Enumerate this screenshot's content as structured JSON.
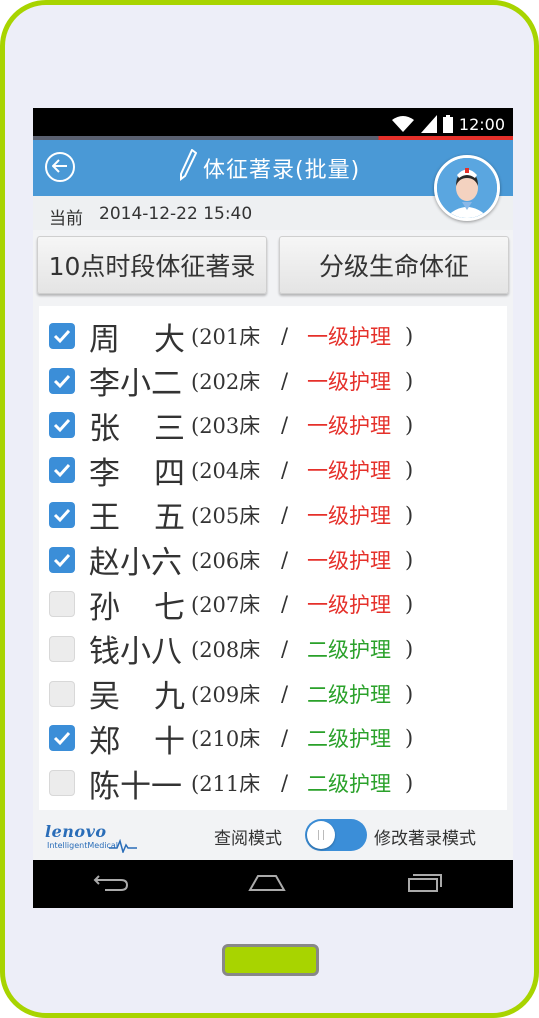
{
  "status_bar": {
    "time": "12:00"
  },
  "header": {
    "title": "体征著录(批量)"
  },
  "date": {
    "label": "当前",
    "value": "2014-12-22 15:40"
  },
  "buttons": {
    "vitals_record": "10点时段体征著录",
    "graded_vitals": "分级生命体征"
  },
  "patients": [
    {
      "name": "周",
      "name2": "大",
      "bed": "(201床",
      "slash": "/",
      "level": "一级护理",
      "close": ")",
      "checked": true,
      "level_color": "#e5302a"
    },
    {
      "name": "李小二",
      "name2": "",
      "bed": "(202床",
      "slash": "/",
      "level": "一级护理",
      "close": ")",
      "checked": true,
      "level_color": "#e5302a"
    },
    {
      "name": "张",
      "name2": "三",
      "bed": "(203床",
      "slash": "/",
      "level": "一级护理",
      "close": ")",
      "checked": true,
      "level_color": "#e5302a"
    },
    {
      "name": "李",
      "name2": "四",
      "bed": "(204床",
      "slash": "/",
      "level": "一级护理",
      "close": ")",
      "checked": true,
      "level_color": "#e5302a"
    },
    {
      "name": "王",
      "name2": "五",
      "bed": "(205床",
      "slash": "/",
      "level": "一级护理",
      "close": ")",
      "checked": true,
      "level_color": "#e5302a"
    },
    {
      "name": "赵小六",
      "name2": "",
      "bed": "(206床",
      "slash": "/",
      "level": "一级护理",
      "close": ")",
      "checked": true,
      "level_color": "#e5302a"
    },
    {
      "name": "孙",
      "name2": "七",
      "bed": "(207床",
      "slash": "/",
      "level": "一级护理",
      "close": ")",
      "checked": false,
      "level_color": "#e5302a"
    },
    {
      "name": "钱小八",
      "name2": "",
      "bed": "(208床",
      "slash": "/",
      "level": "二级护理",
      "close": ")",
      "checked": false,
      "level_color": "#2aa12a"
    },
    {
      "name": "吴",
      "name2": "九",
      "bed": "(209床",
      "slash": "/",
      "level": "二级护理",
      "close": ")",
      "checked": false,
      "level_color": "#2aa12a"
    },
    {
      "name": "郑",
      "name2": "十",
      "bed": "(210床",
      "slash": "/",
      "level": "二级护理",
      "close": ")",
      "checked": true,
      "level_color": "#2aa12a"
    },
    {
      "name": "陈十一",
      "name2": "",
      "bed": "(211床",
      "slash": "/",
      "level": "二级护理",
      "close": ")",
      "checked": false,
      "level_color": "#2aa12a"
    }
  ],
  "footer": {
    "logo_main": "lenovo",
    "logo_sub": "IntelligentMedical",
    "mode_view": "查阅模式",
    "mode_edit": "修改著录模式",
    "toggle_on": true
  },
  "colors": {
    "primary": "#4a99d6",
    "checkbox": "#3b8ed8",
    "level1": "#e5302a",
    "level2": "#2aa12a",
    "frame": "#a8d400"
  },
  "icons": [
    "back-icon",
    "pencil-icon",
    "wifi-icon",
    "signal-icon",
    "battery-icon",
    "nurse-avatar",
    "nav-back-icon",
    "nav-home-icon",
    "nav-recent-icon"
  ]
}
